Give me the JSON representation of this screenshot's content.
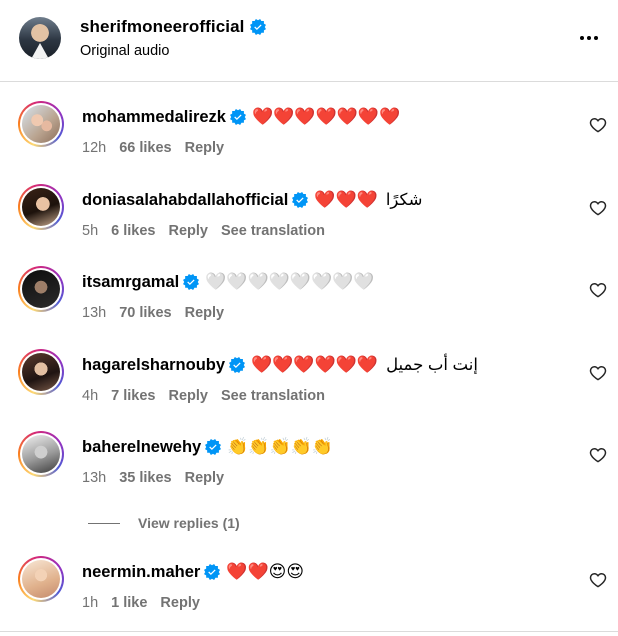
{
  "header": {
    "username": "sherifmoneerofficial",
    "subtitle": "Original audio"
  },
  "colors": {
    "verified": "#0095f6",
    "heart": "#ff3040",
    "meta_text": "#737373"
  },
  "comments": [
    {
      "username": "mohammedalirezk",
      "text": "❤️❤️❤️❤️❤️❤️❤️",
      "time": "12h",
      "likes": "66 likes",
      "reply": "Reply"
    },
    {
      "username": "doniasalahabdallahofficial",
      "text": "❤️❤️❤️",
      "arabic": "شكرًا",
      "time": "5h",
      "likes": "6 likes",
      "reply": "Reply",
      "translate": "See translation"
    },
    {
      "username": "itsamrgamal",
      "text": "🤍🤍🤍🤍🤍🤍🤍🤍",
      "time": "13h",
      "likes": "70 likes",
      "reply": "Reply"
    },
    {
      "username": "hagarelsharnouby",
      "text": "❤️❤️❤️❤️❤️❤️",
      "arabic": "إنت أب جميل",
      "time": "4h",
      "likes": "7 likes",
      "reply": "Reply",
      "translate": "See translation"
    },
    {
      "username": "baherelnewehy",
      "text": "👏👏👏👏👏",
      "time": "13h",
      "likes": "35 likes",
      "reply": "Reply"
    },
    {
      "username": "neermin.maher",
      "text": "❤️❤️😍😍",
      "time": "1h",
      "likes": "1 like",
      "reply": "Reply"
    }
  ],
  "view_replies": "View replies (1)"
}
